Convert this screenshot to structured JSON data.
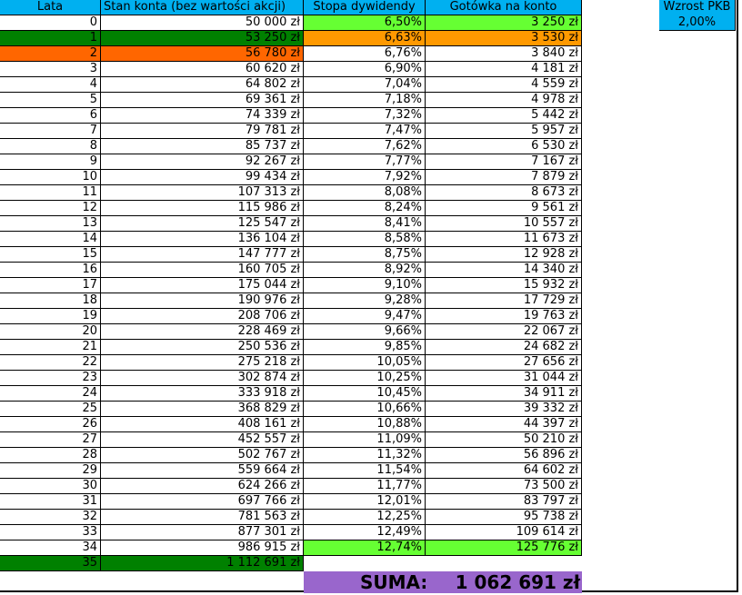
{
  "headers": {
    "years": "Lata",
    "balance": "Stan konta (bez wartości akcji)",
    "dividend_rate": "Stopa dywidendy",
    "cash": "Gotówka na konto"
  },
  "gdp": {
    "label": "Wzrost PKB",
    "value": "2,00%"
  },
  "colors": {
    "header": "#00b0f0",
    "dark_green": "#008000",
    "orange": "#ff6600",
    "light_green": "#66ff33",
    "light_orange": "#ff9900",
    "summary": "#9966cc"
  },
  "rows": [
    {
      "year": "0",
      "balance": "50 000 zł",
      "rate": "6,50%",
      "cash": "3 250 zł"
    },
    {
      "year": "1",
      "balance": "53 250 zł",
      "rate": "6,63%",
      "cash": "3 530 zł"
    },
    {
      "year": "2",
      "balance": "56 780 zł",
      "rate": "6,76%",
      "cash": "3 840 zł"
    },
    {
      "year": "3",
      "balance": "60 620 zł",
      "rate": "6,90%",
      "cash": "4 181 zł"
    },
    {
      "year": "4",
      "balance": "64 802 zł",
      "rate": "7,04%",
      "cash": "4 559 zł"
    },
    {
      "year": "5",
      "balance": "69 361 zł",
      "rate": "7,18%",
      "cash": "4 978 zł"
    },
    {
      "year": "6",
      "balance": "74 339 zł",
      "rate": "7,32%",
      "cash": "5 442 zł"
    },
    {
      "year": "7",
      "balance": "79 781 zł",
      "rate": "7,47%",
      "cash": "5 957 zł"
    },
    {
      "year": "8",
      "balance": "85 737 zł",
      "rate": "7,62%",
      "cash": "6 530 zł"
    },
    {
      "year": "9",
      "balance": "92 267 zł",
      "rate": "7,77%",
      "cash": "7 167 zł"
    },
    {
      "year": "10",
      "balance": "99 434 zł",
      "rate": "7,92%",
      "cash": "7 879 zł"
    },
    {
      "year": "11",
      "balance": "107 313 zł",
      "rate": "8,08%",
      "cash": "8 673 zł"
    },
    {
      "year": "12",
      "balance": "115 986 zł",
      "rate": "8,24%",
      "cash": "9 561 zł"
    },
    {
      "year": "13",
      "balance": "125 547 zł",
      "rate": "8,41%",
      "cash": "10 557 zł"
    },
    {
      "year": "14",
      "balance": "136 104 zł",
      "rate": "8,58%",
      "cash": "11 673 zł"
    },
    {
      "year": "15",
      "balance": "147 777 zł",
      "rate": "8,75%",
      "cash": "12 928 zł"
    },
    {
      "year": "16",
      "balance": "160 705 zł",
      "rate": "8,92%",
      "cash": "14 340 zł"
    },
    {
      "year": "17",
      "balance": "175 044 zł",
      "rate": "9,10%",
      "cash": "15 932 zł"
    },
    {
      "year": "18",
      "balance": "190 976 zł",
      "rate": "9,28%",
      "cash": "17 729 zł"
    },
    {
      "year": "19",
      "balance": "208 706 zł",
      "rate": "9,47%",
      "cash": "19 763 zł"
    },
    {
      "year": "20",
      "balance": "228 469 zł",
      "rate": "9,66%",
      "cash": "22 067 zł"
    },
    {
      "year": "21",
      "balance": "250 536 zł",
      "rate": "9,85%",
      "cash": "24 682 zł"
    },
    {
      "year": "22",
      "balance": "275 218 zł",
      "rate": "10,05%",
      "cash": "27 656 zł"
    },
    {
      "year": "23",
      "balance": "302 874 zł",
      "rate": "10,25%",
      "cash": "31 044 zł"
    },
    {
      "year": "24",
      "balance": "333 918 zł",
      "rate": "10,45%",
      "cash": "34 911 zł"
    },
    {
      "year": "25",
      "balance": "368 829 zł",
      "rate": "10,66%",
      "cash": "39 332 zł"
    },
    {
      "year": "26",
      "balance": "408 161 zł",
      "rate": "10,88%",
      "cash": "44 397 zł"
    },
    {
      "year": "27",
      "balance": "452 557 zł",
      "rate": "11,09%",
      "cash": "50 210 zł"
    },
    {
      "year": "28",
      "balance": "502 767 zł",
      "rate": "11,32%",
      "cash": "56 896 zł"
    },
    {
      "year": "29",
      "balance": "559 664 zł",
      "rate": "11,54%",
      "cash": "64 602 zł"
    },
    {
      "year": "30",
      "balance": "624 266 zł",
      "rate": "11,77%",
      "cash": "73 500 zł"
    },
    {
      "year": "31",
      "balance": "697 766 zł",
      "rate": "12,01%",
      "cash": "83 797 zł"
    },
    {
      "year": "32",
      "balance": "781 563 zł",
      "rate": "12,25%",
      "cash": "95 738 zł"
    },
    {
      "year": "33",
      "balance": "877 301 zł",
      "rate": "12,49%",
      "cash": "109 614 zł"
    },
    {
      "year": "34",
      "balance": "986 915 zł",
      "rate": "12,74%",
      "cash": "125 776 zł"
    },
    {
      "year": "35",
      "balance": "1 112 691 zł",
      "rate": "",
      "cash": ""
    }
  ],
  "summary": {
    "label": "SUMA:",
    "value": "1 062 691 zł"
  }
}
